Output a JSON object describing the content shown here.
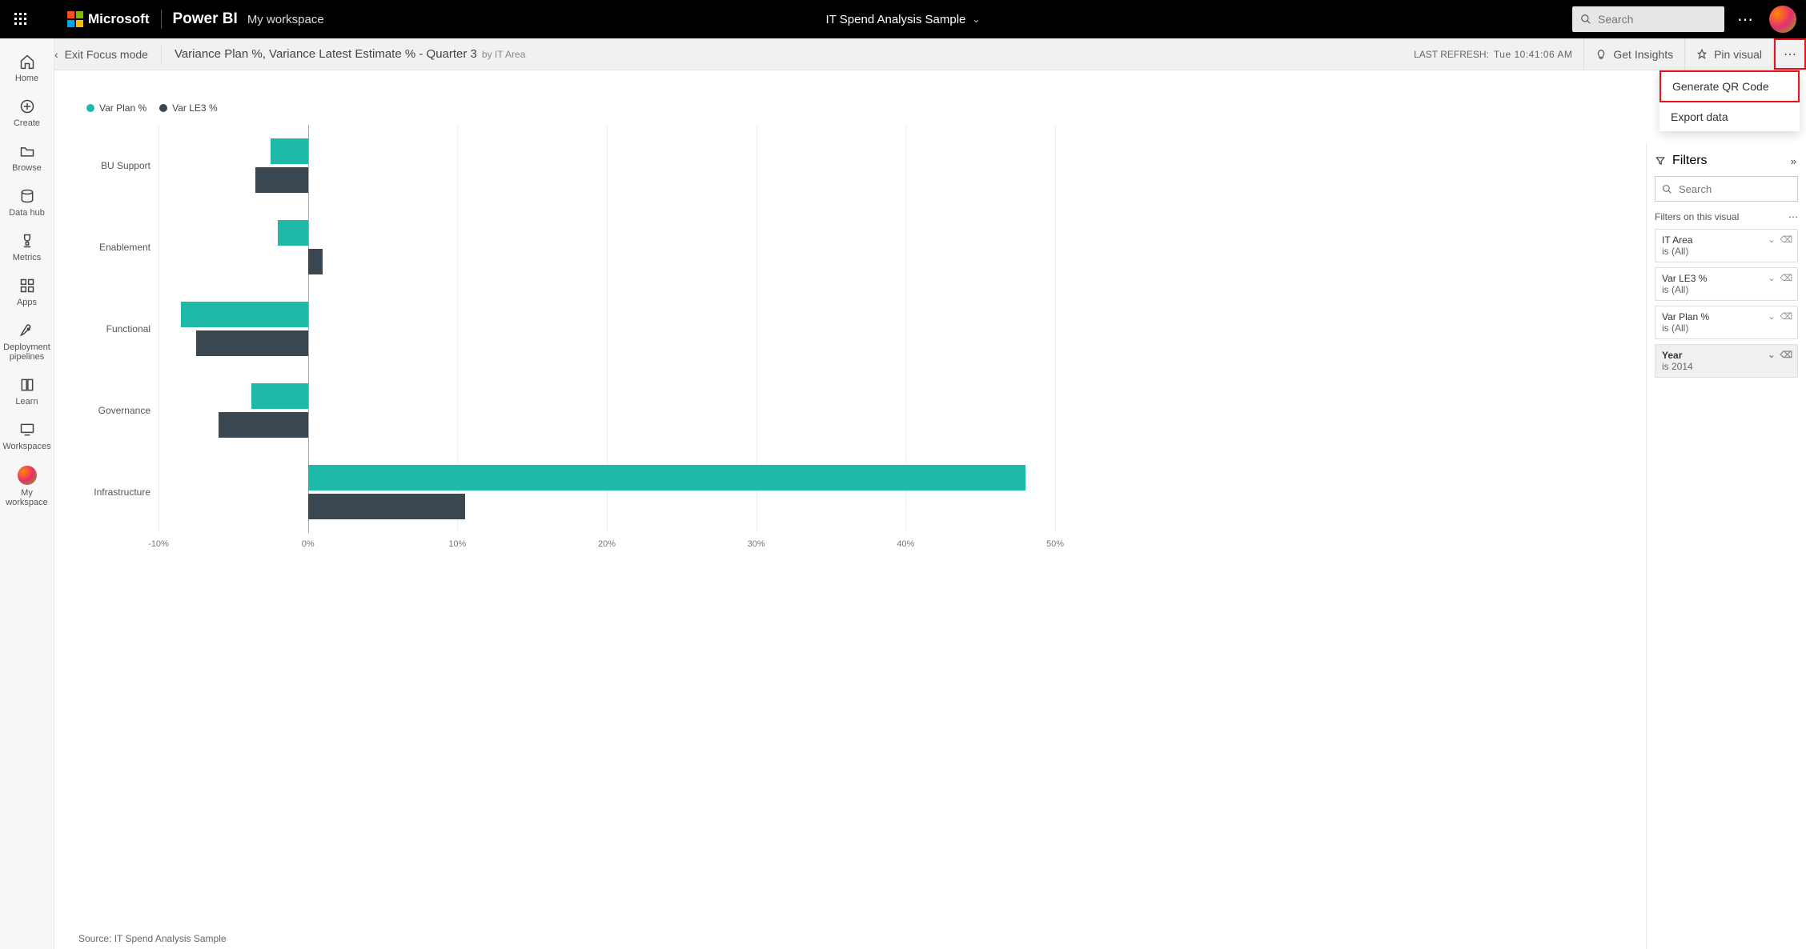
{
  "header": {
    "brand": "Microsoft",
    "product": "Power BI",
    "workspace_link": "My workspace",
    "center_title": "IT Spend Analysis Sample",
    "search_placeholder": "Search"
  },
  "subheader": {
    "exit_focus": "Exit Focus mode",
    "viz_title": "Variance Plan %, Variance Latest Estimate % - Quarter 3",
    "viz_sub": "by IT Area",
    "last_refresh_label": "LAST REFRESH:",
    "last_refresh_value": "Tue 10:41:06 AM",
    "get_insights": "Get Insights",
    "pin_visual": "Pin visual"
  },
  "dropdown": {
    "generate_qr": "Generate QR Code",
    "export_data": "Export data"
  },
  "rail": {
    "home": "Home",
    "create": "Create",
    "browse": "Browse",
    "datahub": "Data hub",
    "metrics": "Metrics",
    "apps": "Apps",
    "deployment": "Deployment pipelines",
    "learn": "Learn",
    "workspaces": "Workspaces",
    "myworkspace": "My workspace"
  },
  "legend": {
    "series1": "Var Plan %",
    "series2": "Var LE3 %"
  },
  "source_note": "Source: IT Spend Analysis Sample",
  "filters": {
    "title": "Filters",
    "search_placeholder": "Search",
    "section_label": "Filters on this visual",
    "cards": [
      {
        "name": "IT Area",
        "sub": "is (All)"
      },
      {
        "name": "Var LE3 %",
        "sub": "is (All)"
      },
      {
        "name": "Var Plan %",
        "sub": "is (All)"
      },
      {
        "name": "Year",
        "sub": "is 2014",
        "active": true
      }
    ]
  },
  "chart_data": {
    "type": "bar",
    "orientation": "horizontal",
    "categories": [
      "BU Support",
      "Enablement",
      "Functional",
      "Governance",
      "Infrastructure"
    ],
    "series": [
      {
        "name": "Var Plan %",
        "color": "#1fb9a8",
        "values": [
          -2.5,
          -2.0,
          -8.5,
          -3.8,
          48.0
        ]
      },
      {
        "name": "Var LE3 %",
        "color": "#3a4750",
        "values": [
          -3.5,
          1.0,
          -7.5,
          -6.0,
          10.5
        ]
      }
    ],
    "xlim": [
      -10,
      50
    ],
    "xticks": [
      -10,
      0,
      10,
      20,
      30,
      40,
      50
    ],
    "xtick_labels": [
      "-10%",
      "0%",
      "10%",
      "20%",
      "30%",
      "40%",
      "50%"
    ],
    "xlabel": "",
    "ylabel": "",
    "title": "Variance Plan %, Variance Latest Estimate % - Quarter 3 by IT Area"
  }
}
